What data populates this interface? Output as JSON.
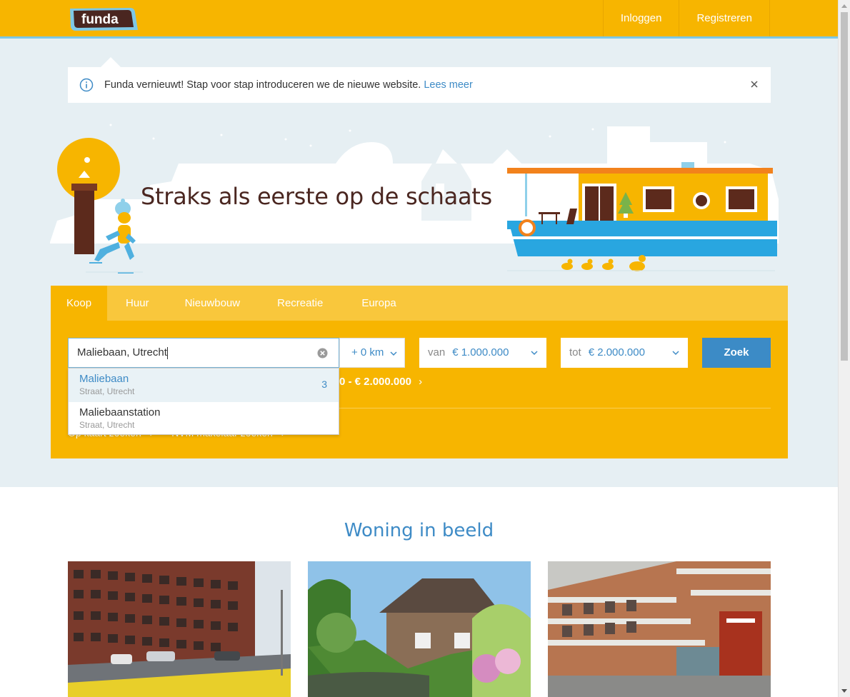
{
  "header": {
    "logo_text": "funda",
    "login": "Inloggen",
    "register": "Registreren"
  },
  "notice": {
    "text": "Funda vernieuwt! Stap voor stap introduceren we de nieuwe website.",
    "link": "Lees meer"
  },
  "hero": {
    "title": "Straks als eerste op de schaats"
  },
  "search": {
    "tabs": [
      {
        "label": "Koop",
        "active": true
      },
      {
        "label": "Huur",
        "active": false
      },
      {
        "label": "Nieuwbouw",
        "active": false
      },
      {
        "label": "Recreatie",
        "active": false
      },
      {
        "label": "Europa",
        "active": false
      }
    ],
    "location_value": "Maliebaan, Utrecht",
    "radius": "+ 0 km",
    "price_from_label": "van",
    "price_from": "€ 1.000.000",
    "price_to_label": "tot",
    "price_to": "€ 2.000.000",
    "submit": "Zoek",
    "saved_search_text": "0 - € 2.000.000",
    "bottom_link_1": "Op kaart zoeken",
    "bottom_link_2": "NVM makelaar zoeken"
  },
  "autocomplete": [
    {
      "name": "Maliebaan",
      "sub": "Straat, Utrecht",
      "count": "3"
    },
    {
      "name": "Maliebaanstation",
      "sub": "Straat, Utrecht",
      "count": ""
    }
  ],
  "section": {
    "title": "Woning in beeld"
  },
  "colors": {
    "brand_orange": "#f7b500",
    "accent_blue": "#3e8bc6",
    "hero_bg": "#e6eff3",
    "title_brown": "#4a2620"
  }
}
